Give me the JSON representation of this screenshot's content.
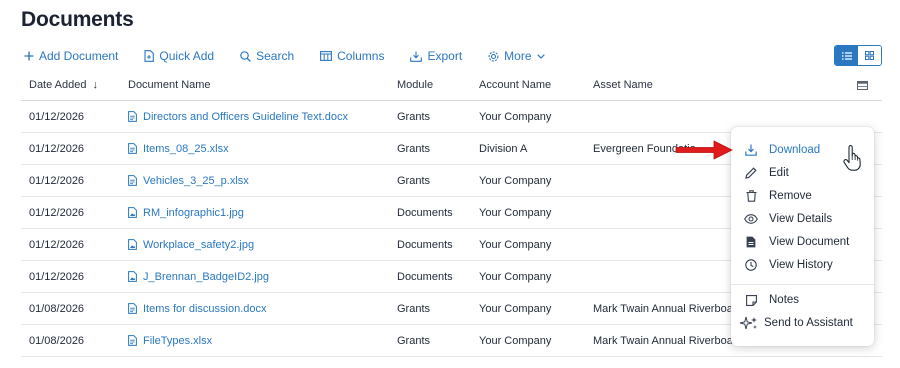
{
  "page": {
    "title": "Documents"
  },
  "toolbar": {
    "add_document": "Add Document",
    "quick_add": "Quick Add",
    "search": "Search",
    "columns": "Columns",
    "export": "Export",
    "more": "More"
  },
  "view_toggle": {
    "active": "list",
    "options": [
      "list-icon",
      "grid-icon"
    ]
  },
  "table": {
    "headers": {
      "date": "Date Added",
      "name": "Document Name",
      "module": "Module",
      "account": "Account Name",
      "asset": "Asset Name"
    },
    "sort": {
      "column": "date",
      "direction": "descending"
    },
    "rows": [
      {
        "date": "01/12/2026",
        "name": "Directors and Officers Guideline Text.docx",
        "module": "Grants",
        "account": "Your Company",
        "asset": ""
      },
      {
        "date": "01/12/2026",
        "name": "Items_08_25.xlsx",
        "module": "Grants",
        "account": "Division A",
        "asset": "Evergreen Foundatio"
      },
      {
        "date": "01/12/2026",
        "name": "Vehicles_3_25_p.xlsx",
        "module": "Grants",
        "account": "Your Company",
        "asset": ""
      },
      {
        "date": "01/12/2026",
        "name": "RM_infographic1.jpg",
        "module": "Documents",
        "account": "Your Company",
        "asset": ""
      },
      {
        "date": "01/12/2026",
        "name": "Workplace_safety2.jpg",
        "module": "Documents",
        "account": "Your Company",
        "asset": ""
      },
      {
        "date": "01/12/2026",
        "name": "J_Brennan_BadgeID2.jpg",
        "module": "Documents",
        "account": "Your Company",
        "asset": ""
      },
      {
        "date": "01/08/2026",
        "name": "Items for discussion.docx",
        "module": "Grants",
        "account": "Your Company",
        "asset": "Mark Twain Annual Riverboa"
      },
      {
        "date": "01/08/2026",
        "name": "FileTypes.xlsx",
        "module": "Grants",
        "account": "Your Company",
        "asset": "Mark Twain Annual Riverboa"
      }
    ]
  },
  "context_menu": {
    "items": [
      {
        "label": "Download",
        "icon": "download-icon",
        "highlighted": true
      },
      {
        "label": "Edit",
        "icon": "pencil-icon"
      },
      {
        "label": "Remove",
        "icon": "trash-icon"
      },
      {
        "label": "View Details",
        "icon": "eye-icon"
      },
      {
        "label": "View Document",
        "icon": "document-icon"
      },
      {
        "label": "View History",
        "icon": "clock-icon"
      },
      {
        "label": "Notes",
        "icon": "note-icon"
      },
      {
        "label": "Send to Assistant",
        "icon": "sparkle-icon"
      }
    ]
  },
  "colors": {
    "accent": "#2a78c2",
    "annotation_arrow": "#e01b1b",
    "title": "#1b2333"
  }
}
